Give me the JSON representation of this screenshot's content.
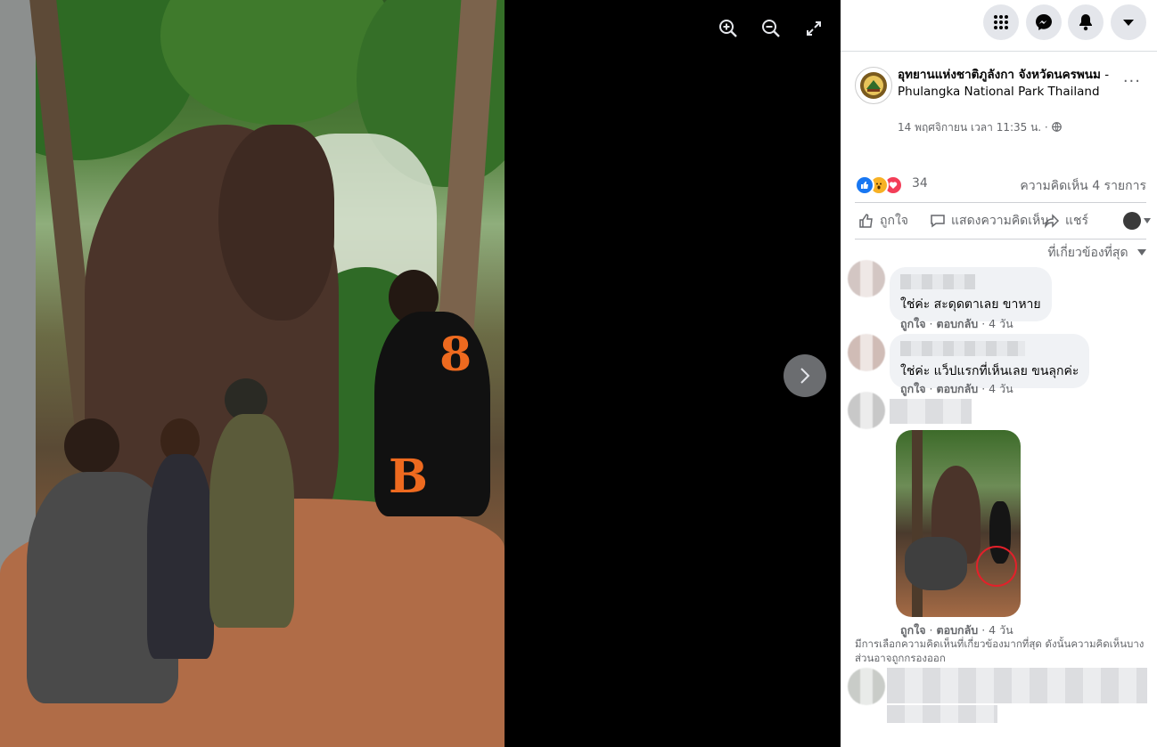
{
  "viewer": {
    "zoom_in_icon": "zoom-in-icon",
    "zoom_out_icon": "zoom-out-icon",
    "fullscreen_icon": "fullscreen-icon",
    "next_icon": "chevron-right-icon",
    "photo_numerals": [
      "8",
      "B"
    ]
  },
  "topbar": {
    "icons": [
      "menu-grid-icon",
      "messenger-icon",
      "notifications-icon",
      "account-dropdown-icon"
    ]
  },
  "post": {
    "page_name_bold": "อุทยานแห่งชาติภูลังกา จังหวัดนครพนม",
    "page_name_rest": " - Phulangka National Park Thailand",
    "timestamp": "14 พฤศจิกายน เวลา 11:35 น. · ",
    "more": "···"
  },
  "reactions": {
    "count": "34",
    "comments_label": "ความคิดเห็น 4 รายการ",
    "colors": {
      "like": "#1877f2",
      "wow": "#f7b125",
      "love": "#f33e58"
    }
  },
  "actions": {
    "like": "ถูกใจ",
    "comment": "แสดงความคิดเห็น",
    "share": "แชร์"
  },
  "sort": {
    "label": "ที่เกี่ยวข้องที่สุด"
  },
  "comments": [
    {
      "text": "ใช่ค่ะ สะดุดตาเลย ขาหาย",
      "like": "ถูกใจ",
      "reply": "ตอบกลับ",
      "time": "4 วัน"
    },
    {
      "text": "ใช่ค่ะ แว็ปแรกที่เห็นเลย ขนลุกค่ะ",
      "like": "ถูกใจ",
      "reply": "ตอบกลับ",
      "time": "4 วัน"
    },
    {
      "text": "",
      "like": "ถูกใจ",
      "reply": "ตอบกลับ",
      "time": "4 วัน"
    }
  ],
  "notice": "มีการเลือกความคิดเห็นที่เกี่ยวข้องมากที่สุด ดังนั้นความคิดเห็นบางส่วนอาจถูกกรองออก"
}
